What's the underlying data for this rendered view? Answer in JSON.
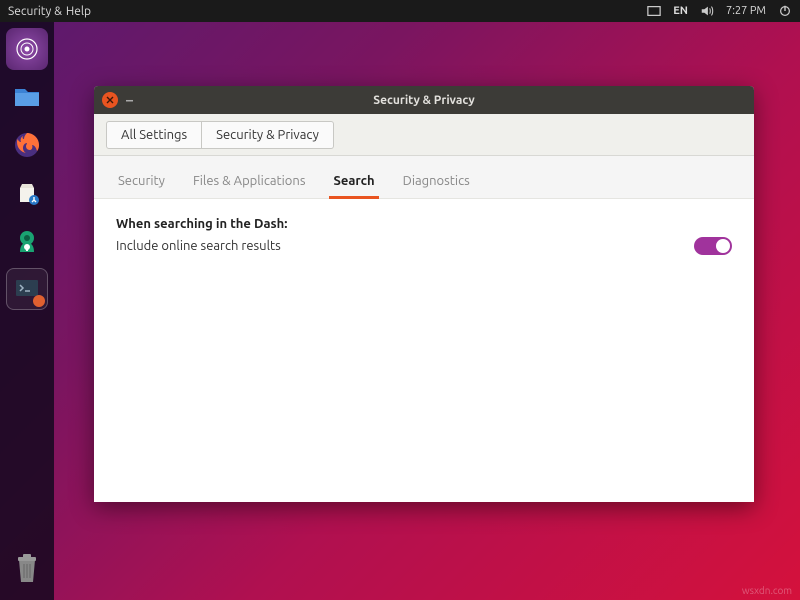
{
  "topbar": {
    "menu1": "Security &",
    "menu2": "Help",
    "lang": "EN",
    "time": "7:27 PM"
  },
  "launcher": {
    "items": [
      {
        "name": "dash-icon",
        "color": "#6b2e8e"
      },
      {
        "name": "files-icon",
        "color": "#2b73c7"
      },
      {
        "name": "firefox-icon",
        "color": "#ff7139"
      },
      {
        "name": "software-icon",
        "color": "#e8e6e0"
      },
      {
        "name": "settings-wrench-icon",
        "color": "#1aa372"
      },
      {
        "name": "terminal-icon",
        "color": "#2c3e50"
      }
    ]
  },
  "window": {
    "title": "Security & Privacy",
    "breadcrumb": {
      "root": "All Settings",
      "current": "Security & Privacy"
    },
    "tabs": [
      {
        "label": "Security",
        "active": false
      },
      {
        "label": "Files & Applications",
        "active": false
      },
      {
        "label": "Search",
        "active": true
      },
      {
        "label": "Diagnostics",
        "active": false
      }
    ],
    "search_pane": {
      "heading": "When searching in the Dash:",
      "option1": "Include online search results",
      "toggle_on": true
    }
  },
  "watermark": "wsxdn.com"
}
